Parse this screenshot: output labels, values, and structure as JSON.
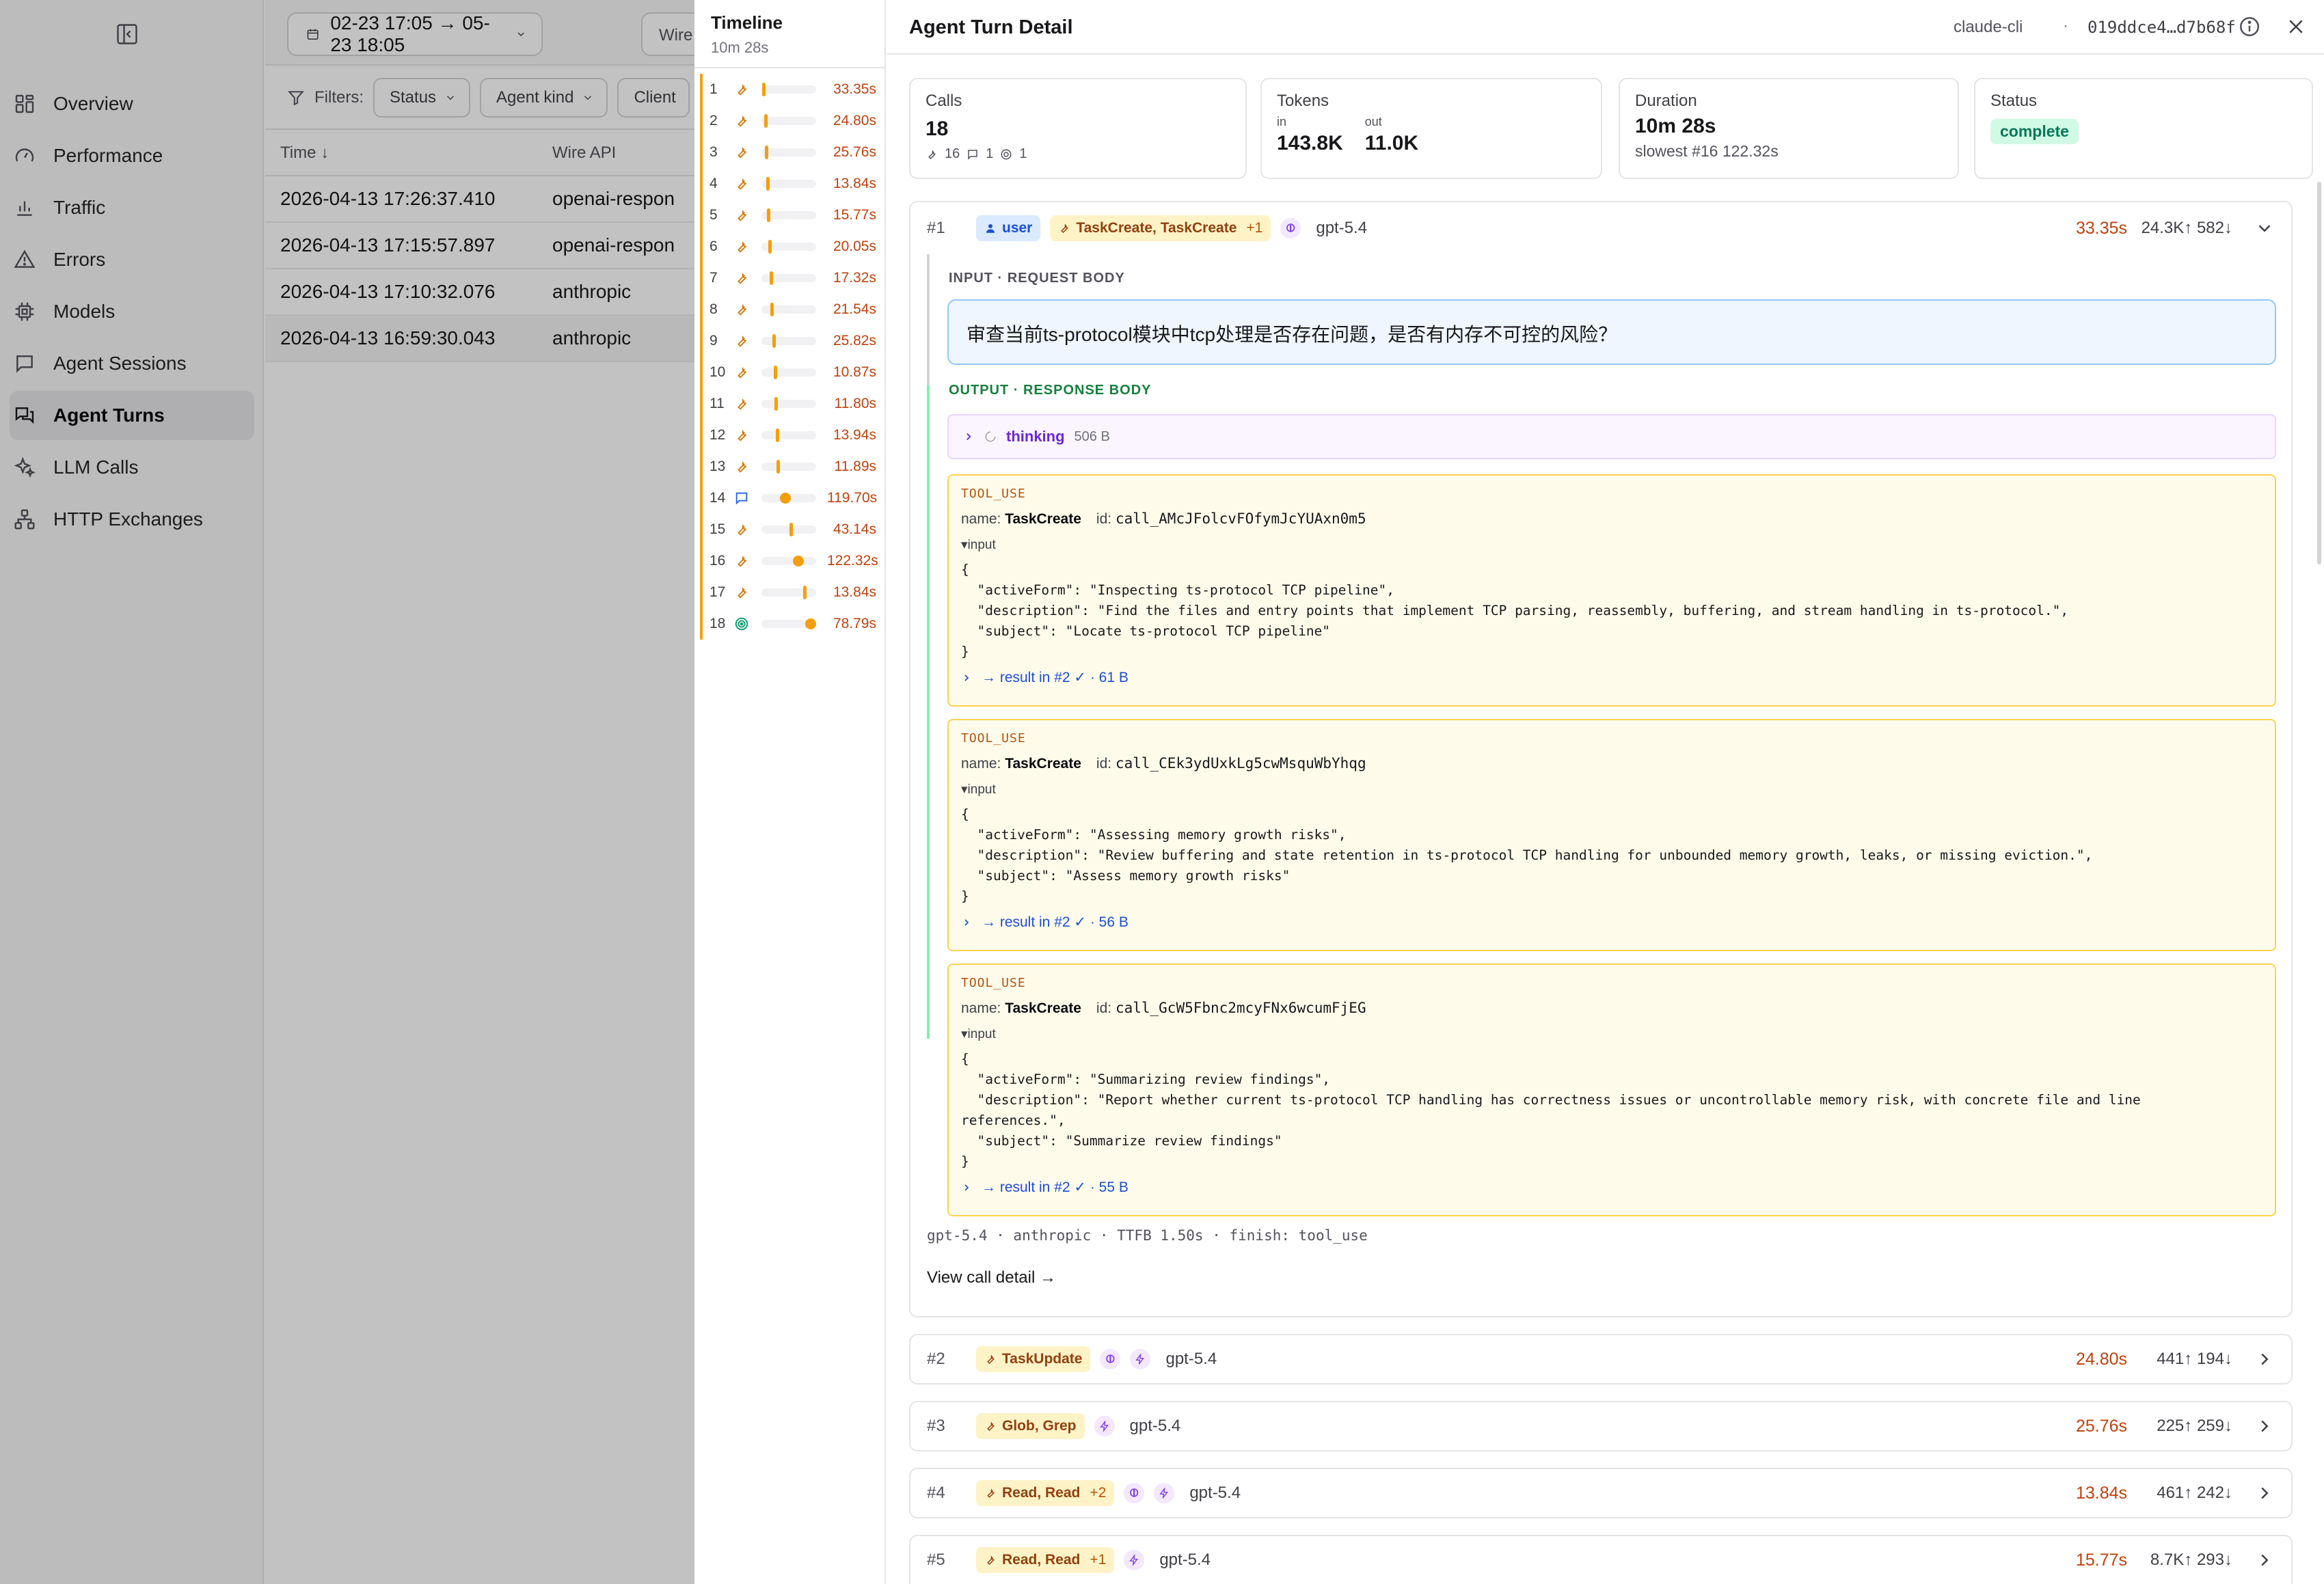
{
  "sidebar": {
    "items": [
      {
        "label": "Overview"
      },
      {
        "label": "Performance"
      },
      {
        "label": "Traffic"
      },
      {
        "label": "Errors"
      },
      {
        "label": "Models"
      },
      {
        "label": "Agent Sessions"
      },
      {
        "label": "Agent Turns",
        "active": true
      },
      {
        "label": "LLM Calls"
      },
      {
        "label": "HTTP Exchanges"
      }
    ]
  },
  "topbar": {
    "date_range": "02-23 17:05 → 05-23 18:05",
    "wire_label": "Wire"
  },
  "filters": {
    "label": "Filters:",
    "status": "Status",
    "agent_kind": "Agent kind",
    "client": "Client"
  },
  "table": {
    "headers": {
      "time": "Time ↓",
      "wire": "Wire API"
    },
    "rows": [
      {
        "time": "2026-04-13 17:26:37.410",
        "wire": "openai-respon"
      },
      {
        "time": "2026-04-13 17:15:57.897",
        "wire": "openai-respon"
      },
      {
        "time": "2026-04-13 17:10:32.076",
        "wire": "anthropic"
      },
      {
        "time": "2026-04-13 16:59:30.043",
        "wire": "anthropic"
      }
    ]
  },
  "timeline": {
    "title": "Timeline",
    "total": "10m 28s",
    "rows": [
      {
        "n": "1",
        "dur": "33.35s",
        "icon": "wrench-icon",
        "pos": 0.02
      },
      {
        "n": "2",
        "dur": "24.80s",
        "icon": "wrench-icon",
        "pos": 0.05
      },
      {
        "n": "3",
        "dur": "25.76s",
        "icon": "wrench-icon",
        "pos": 0.07
      },
      {
        "n": "4",
        "dur": "13.84s",
        "icon": "wrench-icon",
        "pos": 0.09
      },
      {
        "n": "5",
        "dur": "15.77s",
        "icon": "wrench-icon",
        "pos": 0.11
      },
      {
        "n": "6",
        "dur": "20.05s",
        "icon": "wrench-icon",
        "pos": 0.13
      },
      {
        "n": "7",
        "dur": "17.32s",
        "icon": "wrench-icon",
        "pos": 0.16
      },
      {
        "n": "8",
        "dur": "21.54s",
        "icon": "wrench-icon",
        "pos": 0.18
      },
      {
        "n": "9",
        "dur": "25.82s",
        "icon": "wrench-icon",
        "pos": 0.21
      },
      {
        "n": "10",
        "dur": "10.87s",
        "icon": "wrench-icon",
        "pos": 0.24
      },
      {
        "n": "11",
        "dur": "11.80s",
        "icon": "wrench-icon",
        "pos": 0.26
      },
      {
        "n": "12",
        "dur": "13.94s",
        "icon": "wrench-icon",
        "pos": 0.28
      },
      {
        "n": "13",
        "dur": "11.89s",
        "icon": "wrench-icon",
        "pos": 0.3
      },
      {
        "n": "14",
        "dur": "119.70s",
        "icon": "message-icon",
        "pos": 0.36
      },
      {
        "n": "15",
        "dur": "43.14s",
        "icon": "wrench-icon",
        "pos": 0.55
      },
      {
        "n": "16",
        "dur": "122.32s",
        "icon": "wrench-icon",
        "pos": 0.62
      },
      {
        "n": "17",
        "dur": "13.84s",
        "icon": "wrench-icon",
        "pos": 0.82
      },
      {
        "n": "18",
        "dur": "78.79s",
        "icon": "target-icon",
        "pos": 0.86
      }
    ]
  },
  "detail": {
    "title": "Agent Turn Detail",
    "agent": "claude-cli",
    "separator": "·",
    "turn_id": "019ddce4…d7b68f",
    "stats": {
      "calls_label": "Calls",
      "calls": "18",
      "tool_count": "16",
      "msg_count": "1",
      "final_count": "1",
      "tokens_label": "Tokens",
      "in_label": "in",
      "in": "143.8K",
      "out_label": "out",
      "out": "11.0K",
      "duration_label": "Duration",
      "duration": "10m 28s",
      "slowest": "slowest #16 122.32s",
      "status_label": "Status",
      "status": "complete"
    },
    "call1": {
      "num": "#1",
      "role": "user",
      "tools": "TaskCreate, TaskCreate",
      "tools_more": "+1",
      "model": "gpt-5.4",
      "dur": "33.35s",
      "toks": "24.3K↑ 582↓",
      "input_label": "INPUT · REQUEST BODY",
      "input_text": "审查当前ts-protocol模块中tcp处理是否存在问题，是否有内存不可控的风险？",
      "output_label": "OUTPUT · RESPONSE BODY",
      "thinking_label": "thinking",
      "thinking_size": "506 B",
      "tool_uses": [
        {
          "kind": "TOOL_USE",
          "name_label": "name:",
          "name": "TaskCreate",
          "id_label": "id:",
          "id": "call_AMcJFolcvFOfymJcYUAxn0m5",
          "input_label": "▾input",
          "json": "{\n  \"activeForm\": \"Inspecting ts-protocol TCP pipeline\",\n  \"description\": \"Find the files and entry points that implement TCP parsing, reassembly, buffering, and stream handling in ts-protocol.\",\n  \"subject\": \"Locate ts-protocol TCP pipeline\"\n}",
          "result": "→ result in #2 ✓ · 61 B"
        },
        {
          "kind": "TOOL_USE",
          "name_label": "name:",
          "name": "TaskCreate",
          "id_label": "id:",
          "id": "call_CEk3ydUxkLg5cwMsquWbYhqg",
          "input_label": "▾input",
          "json": "{\n  \"activeForm\": \"Assessing memory growth risks\",\n  \"description\": \"Review buffering and state retention in ts-protocol TCP handling for unbounded memory growth, leaks, or missing eviction.\",\n  \"subject\": \"Assess memory growth risks\"\n}",
          "result": "→ result in #2 ✓ · 56 B"
        },
        {
          "kind": "TOOL_USE",
          "name_label": "name:",
          "name": "TaskCreate",
          "id_label": "id:",
          "id": "call_GcW5Fbnc2mcyFNx6wcumFjEG",
          "input_label": "▾input",
          "json": "{\n  \"activeForm\": \"Summarizing review findings\",\n  \"description\": \"Report whether current ts-protocol TCP handling has correctness issues or uncontrollable memory risk, with concrete file and line\nreferences.\",\n  \"subject\": \"Summarize review findings\"\n}",
          "result": "→ result in #2 ✓ · 55 B"
        }
      ],
      "footer": "gpt-5.4 · anthropic · TTFB 1.50s · finish: tool_use",
      "view_link": "View call detail →"
    },
    "calls": [
      {
        "num": "#2",
        "tools": "TaskUpdate",
        "more": "",
        "model": "gpt-5.4",
        "dur": "24.80s",
        "toks": "441↑ 194↓"
      },
      {
        "num": "#3",
        "tools": "Glob, Grep",
        "more": "",
        "model": "gpt-5.4",
        "dur": "25.76s",
        "toks": "225↑ 259↓"
      },
      {
        "num": "#4",
        "tools": "Read, Read",
        "more": "+2",
        "model": "gpt-5.4",
        "dur": "13.84s",
        "toks": "461↑ 242↓"
      },
      {
        "num": "#5",
        "tools": "Read, Read",
        "more": "+1",
        "model": "gpt-5.4",
        "dur": "15.77s",
        "toks": "8.7K↑ 293↓"
      }
    ]
  },
  "colors": {
    "accent_orange": "#f59e0b",
    "duration_text": "#c2410c",
    "status_green": "#047857",
    "link_blue": "#1d4ed8"
  }
}
